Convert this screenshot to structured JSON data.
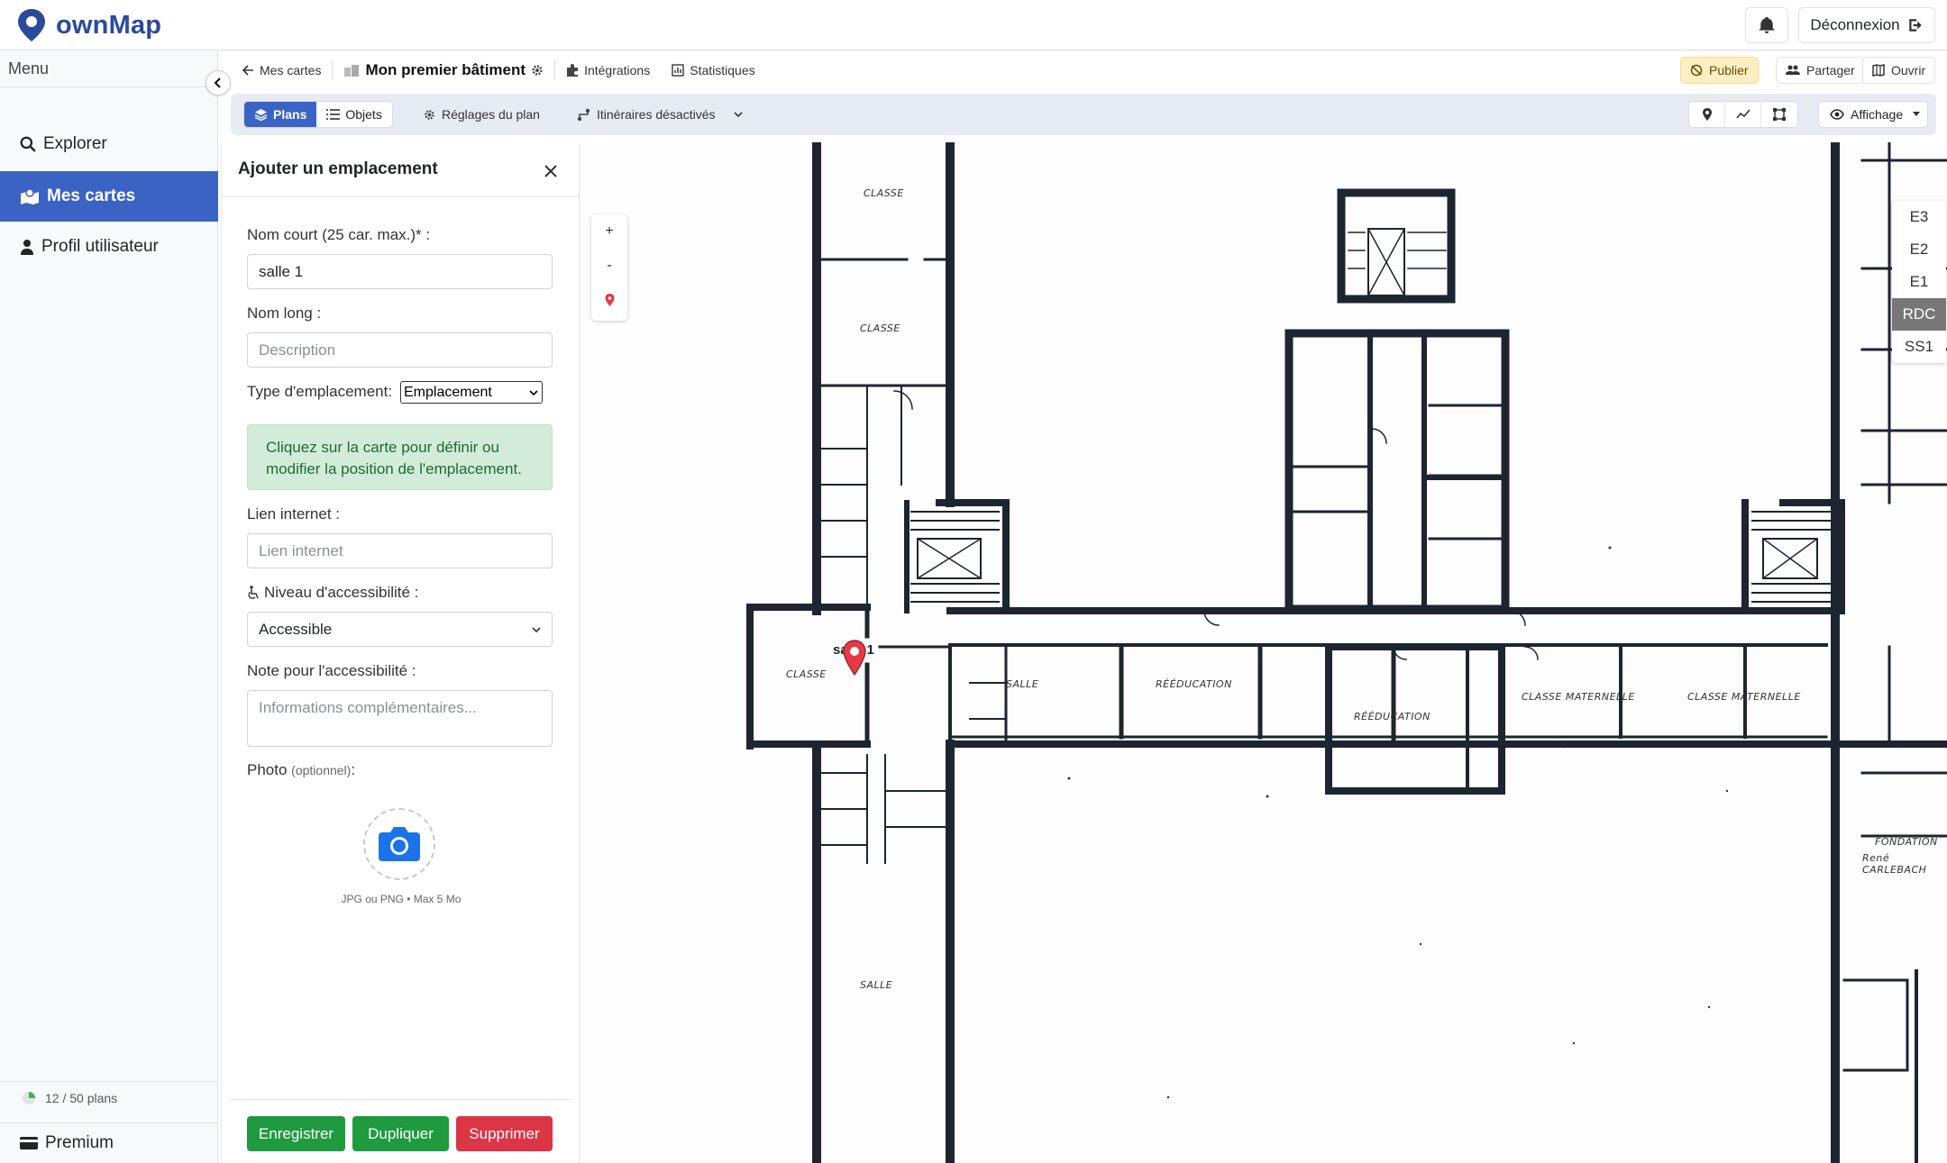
{
  "brand": {
    "name": "ownMap"
  },
  "header": {
    "logout_label": "Déconnexion"
  },
  "sidebar": {
    "menu_title": "Menu",
    "items": [
      {
        "label": "Explorer",
        "icon": "search-icon"
      },
      {
        "label": "Mes cartes",
        "icon": "maps-icon",
        "active": true
      },
      {
        "label": "Profil utilisateur",
        "icon": "user-icon"
      }
    ],
    "quota": "12 / 50 plans",
    "quota_fraction": 0.24,
    "premium": "Premium"
  },
  "breadcrumb": {
    "back": "Mes cartes",
    "map_title": "Mon premier bâtiment",
    "integrations": "Intégrations",
    "statistics": "Statistiques",
    "publish": "Publier",
    "share": "Partager",
    "open": "Ouvrir"
  },
  "toolbar": {
    "plans": "Plans",
    "objects": "Objets",
    "plan_settings": "Réglages du plan",
    "routes": "Itinéraires désactivés",
    "display": "Affichage"
  },
  "form": {
    "title": "Ajouter un emplacement",
    "short_name_label": "Nom court (25 car. max.)* :",
    "short_name_value": "salle 1",
    "long_name_label": "Nom long :",
    "long_name_placeholder": "Description",
    "type_label": "Type d'emplacement:",
    "type_value": "Emplacement",
    "hint": "Cliquez sur la carte pour définir ou modifier la position de l'emplacement.",
    "link_label": "Lien internet :",
    "link_placeholder": "Lien internet",
    "accessibility_label": "Niveau d'accessibilité :",
    "accessibility_value": "Accessible",
    "accessibility_note_label": "Note pour l'accessibilité :",
    "accessibility_note_placeholder": "Informations complémentaires...",
    "photo_label": "Photo",
    "photo_optional": "(optionnel)",
    "photo_hint": "JPG ou PNG • Max 5 Mo",
    "save": "Enregistrer",
    "duplicate": "Dupliquer",
    "delete": "Supprimer"
  },
  "map": {
    "zoom_in": "+",
    "zoom_out": "-",
    "floors": [
      "E3",
      "E2",
      "E1",
      "RDC",
      "SS1"
    ],
    "active_floor": "RDC",
    "pin_label": "salle 1",
    "rooms": [
      "CLASSE",
      "CLASSE",
      "CLASSE",
      "SALLE",
      "RÉÉDUCATION",
      "RÉÉDUCATION",
      "CLASSE MATERNELLE",
      "CLASSE MATERNELLE",
      "SALLE",
      "FONDATION",
      "René CARLEBACH"
    ]
  },
  "colors": {
    "primary": "#3b63c4",
    "success": "#1f9a3f",
    "danger": "#dc3545",
    "brand": "#2b4a9b"
  }
}
